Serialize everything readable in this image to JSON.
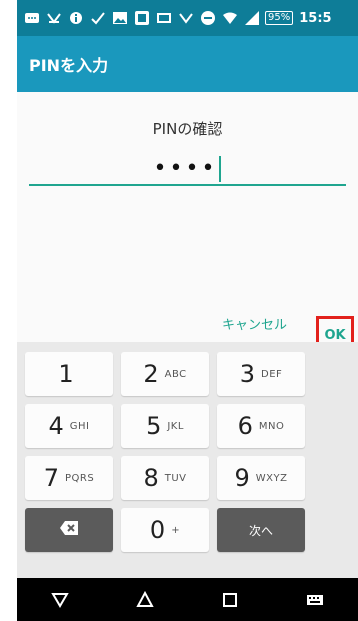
{
  "status_bar": {
    "battery": "95%",
    "time": "15:5",
    "icons": [
      "message-icon",
      "app-icon",
      "info-icon",
      "check-icon",
      "image-icon",
      "app-icon",
      "image-icon",
      "app-icon",
      "dnd-icon",
      "wifi-icon",
      "signal-icon"
    ]
  },
  "app_bar": {
    "title": "PINを入力"
  },
  "dialog": {
    "title": "PINの確認",
    "pin_value": "••••",
    "cancel_label": "キャンセル",
    "ok_label": "OK"
  },
  "keypad": {
    "rows": [
      [
        {
          "num": "1",
          "letters": ""
        },
        {
          "num": "2",
          "letters": "ABC"
        },
        {
          "num": "3",
          "letters": "DEF"
        }
      ],
      [
        {
          "num": "4",
          "letters": "GHI"
        },
        {
          "num": "5",
          "letters": "JKL"
        },
        {
          "num": "6",
          "letters": "MNO"
        }
      ],
      [
        {
          "num": "7",
          "letters": "PQRS"
        },
        {
          "num": "8",
          "letters": "TUV"
        },
        {
          "num": "9",
          "letters": "WXYZ"
        }
      ],
      [
        {
          "num": "",
          "letters": ""
        },
        {
          "num": "0",
          "letters": "+"
        },
        {
          "num": "",
          "letters": "次へ"
        }
      ]
    ]
  },
  "nav": {
    "icons": [
      "back-icon",
      "home-icon",
      "recents-icon",
      "keyboard-icon"
    ]
  },
  "colors": {
    "status_bar": "#0e7d98",
    "app_bar": "#1a98bd",
    "accent": "#1fa58f",
    "highlight": "#e2211c"
  }
}
